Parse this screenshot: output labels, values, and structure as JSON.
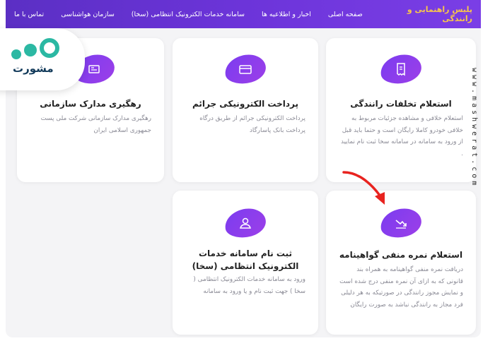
{
  "header": {
    "brand": "پلیس راهنمایی و رانندگی",
    "nav": [
      "صفحه اصلی",
      "اخبار و اطلاعیه ها",
      "سامانه خدمات الکترونیک انتظامی (سخا)",
      "سازمان هواشناسی",
      "تماس با ما"
    ]
  },
  "logo": {
    "text": "مشورت"
  },
  "watermark": "www.mashwerat.com",
  "cards": [
    {
      "title": "استعلام تخلفات رانندگی",
      "desc": "استعلام خلافی و مشاهده جزئیات مربوط به خلافی خودرو کاملا رایگان است و حتما باید قبل از ورود به سامانه در سامانه سخا ثبت نام نمایید .",
      "icon": "receipt-icon"
    },
    {
      "title": "پرداخت الکترونیکی جرائم",
      "desc": "پرداخت الکترونیکی جرائم از طریق درگاه پرداخت بانک پاسارگاد",
      "icon": "credit-card-icon"
    },
    {
      "title": "رهگیری مدارک سازمانی",
      "desc": "رهگیری مدارک سازمانی شرکت ملی پست جمهوری اسلامی ایران",
      "icon": "document-tracking-icon"
    },
    {
      "title": "استعلام نمره منفی گواهینامه",
      "desc": "دریافت نمره منفی گواهینامه به همراه بند قانونی که به ازای آن نمره منفی درج شده است و نمایش مجوز رانندگی در صورتیکه به هر دلیلی فرد مجاز به رانندگی نباشد به صورت رایگان",
      "icon": "trend-down-icon"
    },
    {
      "title": "ثبت نام سامانه خدمات الکترونیک انتظامی (سخا)",
      "desc": "ورود به سامانه خدمات الکترونیک انتظامی ( سخا ) جهت ثبت نام و یا ورود به سامانه",
      "icon": "user-icon"
    }
  ],
  "colors": {
    "accent": "#7b3cf0",
    "header": "#6c34d9",
    "brand": "#f7c64b",
    "arrow": "#e8231f"
  }
}
